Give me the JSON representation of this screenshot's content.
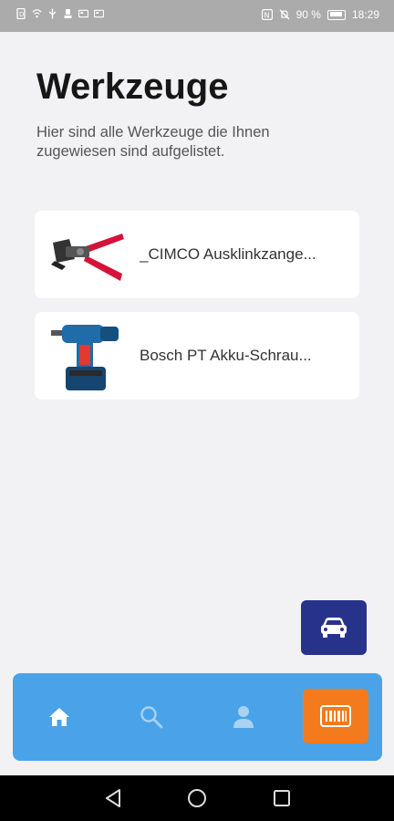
{
  "status_bar": {
    "battery": "90 %",
    "time": "18:29"
  },
  "page": {
    "title": "Werkzeuge",
    "subtitle": "Hier sind alle Werkzeuge die Ihnen zugewiesen sind aufgelistet."
  },
  "tools": [
    {
      "name": "_CIMCO Ausklinkzange...",
      "image": "pliers-image"
    },
    {
      "name": "Bosch PT Akku-Schrau...",
      "image": "drill-image"
    }
  ],
  "fab": {
    "icon": "car-icon"
  },
  "bottom_nav": {
    "items": [
      {
        "icon": "home-icon",
        "active": true
      },
      {
        "icon": "search-icon",
        "active": false
      },
      {
        "icon": "user-icon",
        "active": false
      },
      {
        "icon": "barcode-scan-icon",
        "active": false
      }
    ]
  },
  "colors": {
    "nav_bg": "#4aa3e8",
    "fab_bg": "#27338b",
    "scan_bg": "#f37b1d",
    "page_bg": "#f2f2f4"
  }
}
